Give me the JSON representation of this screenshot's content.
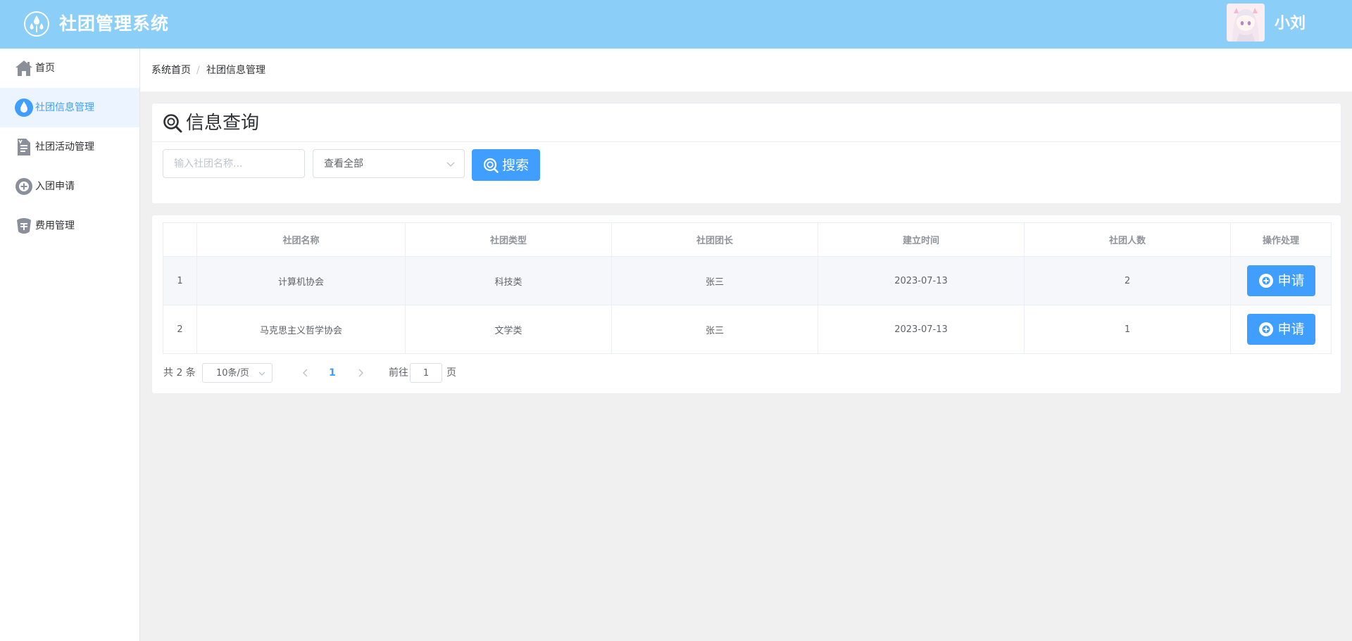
{
  "header": {
    "title": "社团管理系统",
    "username": "小刘",
    "bg_color": "#8bcff8"
  },
  "sidebar": {
    "items": [
      {
        "label": "首页",
        "icon": "home-icon",
        "active": false
      },
      {
        "label": "社团信息管理",
        "icon": "drop-icon",
        "active": true
      },
      {
        "label": "社团活动管理",
        "icon": "document-icon",
        "active": false
      },
      {
        "label": "入团申请",
        "icon": "plus-circle-icon",
        "active": false
      },
      {
        "label": "费用管理",
        "icon": "fee-icon",
        "active": false
      }
    ]
  },
  "breadcrumb": {
    "home": "系统首页",
    "separator": "/",
    "current": "社团信息管理"
  },
  "search": {
    "title": "信息查询",
    "name_placeholder": "输入社团名称...",
    "type_value": "查看全部",
    "button_label": "搜索"
  },
  "table": {
    "columns": [
      "",
      "社团名称",
      "社团类型",
      "社团团长",
      "建立时间",
      "社团人数",
      "操作处理"
    ],
    "rows": [
      {
        "index": "1",
        "name": "计算机协会",
        "type": "科技类",
        "leader": "张三",
        "created": "2023-07-13",
        "members": "2",
        "action": "申请"
      },
      {
        "index": "2",
        "name": "马克思主义哲学协会",
        "type": "文学类",
        "leader": "张三",
        "created": "2023-07-13",
        "members": "1",
        "action": "申请"
      }
    ]
  },
  "pagination": {
    "total": "共 2 条",
    "page_size": "10条/页",
    "current_page": "1",
    "goto_label": "前往",
    "goto_value": "1",
    "page_suffix": "页"
  },
  "colors": {
    "accent": "#409eff",
    "active_bg": "#ecf5ff"
  }
}
